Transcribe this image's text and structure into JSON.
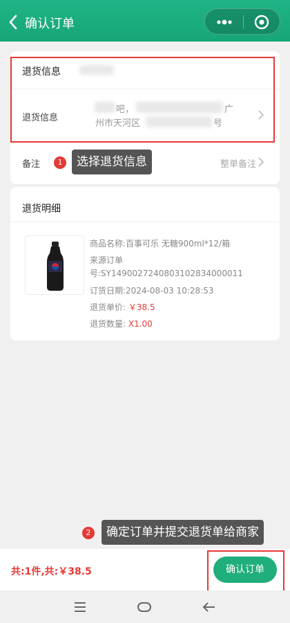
{
  "header": {
    "title": "确认订单"
  },
  "return_info": {
    "section_title": "退货信息",
    "row_label": "退货信息",
    "address_line1": "吧，",
    "address_line1_tail": "广",
    "address_line2": "州市天河区",
    "address_line2_tail": "号"
  },
  "remark": {
    "label": "备注",
    "value": "整单备注"
  },
  "annotations": [
    {
      "number": "1",
      "text": "选择退货信息"
    },
    {
      "number": "2",
      "text": "确定订单并提交退货单给商家"
    }
  ],
  "details": {
    "section_title": "退货明细",
    "product_name": "商品名称:百事可乐 无糖900ml*12/箱",
    "source_order_label": "来源订单",
    "source_order_no": "号:SY14900272408031028340000​11",
    "order_date": "订货日期:2024-08-03 10:28:53",
    "unit_price_label": "退货单价: ",
    "unit_price": "￥38.5",
    "quantity_label": "退货数量: ",
    "quantity": "X1.00"
  },
  "bottom": {
    "total": "共:1件,共:￥38.5",
    "confirm_label": "确认订单"
  },
  "colors": {
    "brand": "#1fae7c",
    "accent_red": "#e53935"
  }
}
